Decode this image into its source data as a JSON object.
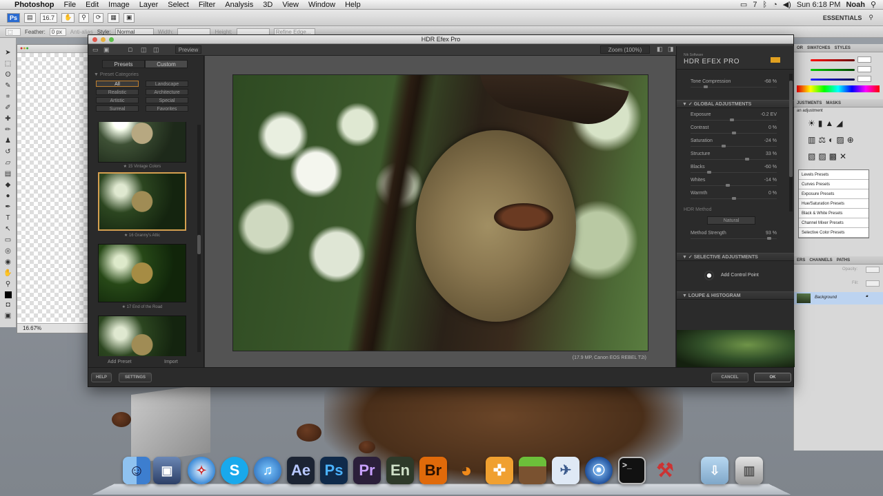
{
  "menubar": {
    "app": "Photoshop",
    "items": [
      "File",
      "Edit",
      "Image",
      "Layer",
      "Select",
      "Filter",
      "Analysis",
      "3D",
      "View",
      "Window",
      "Help"
    ],
    "clock": "Sun 6:18 PM",
    "user": "Noah",
    "battery": "7"
  },
  "ps_options": {
    "zoom": "16.7",
    "workspace": "ESSENTIALS",
    "feather_label": "Feather:",
    "feather_value": "0 px",
    "antialias": "Anti-alias",
    "style_label": "Style:",
    "style_value": "Normal",
    "width_label": "Width:",
    "height_label": "Height:",
    "refine_edge": "Refine Edge..."
  },
  "ps_doc": {
    "zoom_status": "16.67%"
  },
  "hdr": {
    "window_title": "HDR Efex Pro",
    "preview_label": "Preview",
    "zoom_label": "Zoom (100%)",
    "tabs": [
      "Presets",
      "Custom"
    ],
    "category_header": "Preset Categories",
    "categories": [
      "All",
      "Landscape",
      "Realistic",
      "Architecture",
      "Artistic",
      "Special",
      "Surreal",
      "Favorites"
    ],
    "thumbs": [
      {
        "caption": "★ 15 Vintage Colors"
      },
      {
        "caption": "★ 16 Granny's Attic"
      },
      {
        "caption": "★ 17 End of the Road"
      },
      {
        "caption": ""
      }
    ],
    "add_preset": "Add Preset",
    "import": "Import",
    "photo_caption": "(17.9 MP, Canon EOS REBEL T2i)",
    "brand_small": "Nik Software",
    "brand_big": "HDR EFEX PRO",
    "tone": {
      "label": "Tone Compression",
      "value": "-68 %",
      "fraction": 0.16
    },
    "global_header": "GLOBAL ADJUSTMENTS",
    "adjustments": [
      {
        "label": "Exposure",
        "value": "-0.2 EV",
        "fraction": 0.48
      },
      {
        "label": "Contrast",
        "value": "0 %",
        "fraction": 0.5
      },
      {
        "label": "Saturation",
        "value": "-24 %",
        "fraction": 0.38
      },
      {
        "label": "Structure",
        "value": "33 %",
        "fraction": 0.66
      },
      {
        "label": "Blacks",
        "value": "-60 %",
        "fraction": 0.2
      },
      {
        "label": "Whites",
        "value": "-14 %",
        "fraction": 0.43
      },
      {
        "label": "Warmth",
        "value": "0 %",
        "fraction": 0.5
      }
    ],
    "hdr_method_label": "HDR Method",
    "hdr_method_value": "Natural",
    "method_strength": {
      "label": "Method Strength",
      "value": "93 %",
      "fraction": 0.93
    },
    "selective_header": "SELECTIVE ADJUSTMENTS",
    "add_control_point": "Add Control Point",
    "loupe_header": "LOUPE & HISTOGRAM",
    "help": "HELP",
    "settings": "SETTINGS",
    "cancel": "CANCEL",
    "ok": "OK"
  },
  "ps_right": {
    "color_tabs": [
      "OR",
      "SWATCHES",
      "STYLES"
    ],
    "adj_tabs": [
      "JUSTMENTS",
      "MASKS"
    ],
    "adj_hint": "an adjustment",
    "presets": [
      "Levels Presets",
      "Curves Presets",
      "Exposure Presets",
      "Hue/Saturation Presets",
      "Black & White Presets",
      "Channel Mixer Presets",
      "Selective Color Presets"
    ],
    "layer_tabs": [
      "ERS",
      "CHANNELS",
      "PATHS"
    ],
    "opacity_label": "Opacity:",
    "fill_label": "Fill:",
    "layer_name": "Background"
  },
  "dock": {
    "apps": [
      "Finder",
      "Photo Booth",
      "Safari",
      "Skype",
      "iTunes",
      "AE",
      "Ps",
      "Pr",
      "En",
      "Br",
      "Blender",
      "Instruments",
      "Minecraft",
      "Preview",
      "Network",
      "Terminal",
      "Automator",
      "Downloads",
      "Trash"
    ],
    "ae": "Ae",
    "ps": "Ps",
    "pr": "Pr",
    "en": "En",
    "br": "Br"
  }
}
